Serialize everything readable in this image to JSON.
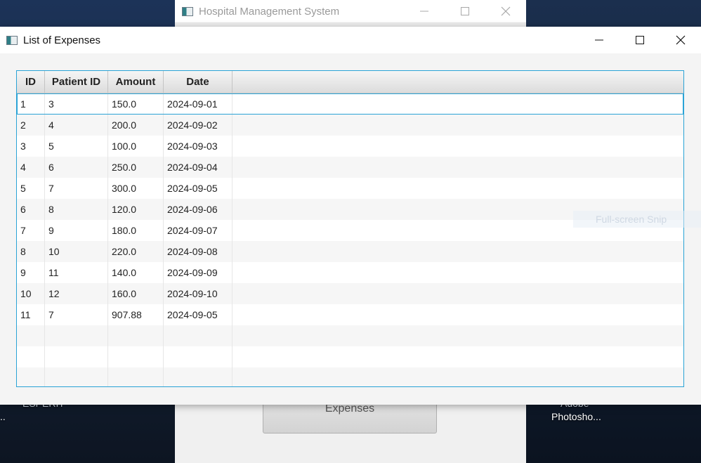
{
  "desktop": {
    "left_partial_label": "ESPERIT",
    "left_dots": "..",
    "right_label_top": "Adobe",
    "right_label_bottom": "Photosho..."
  },
  "back_window": {
    "title": "Hospital Management System",
    "button_label": "Expenses"
  },
  "window": {
    "title": "List of Expenses"
  },
  "table": {
    "columns": [
      "ID",
      "Patient ID",
      "Amount",
      "Date"
    ],
    "rows": [
      [
        "1",
        "3",
        "150.0",
        "2024-09-01"
      ],
      [
        "2",
        "4",
        "200.0",
        "2024-09-02"
      ],
      [
        "3",
        "5",
        "100.0",
        "2024-09-03"
      ],
      [
        "4",
        "6",
        "250.0",
        "2024-09-04"
      ],
      [
        "5",
        "7",
        "300.0",
        "2024-09-05"
      ],
      [
        "6",
        "8",
        "120.0",
        "2024-09-06"
      ],
      [
        "7",
        "9",
        "180.0",
        "2024-09-07"
      ],
      [
        "8",
        "10",
        "220.0",
        "2024-09-08"
      ],
      [
        "9",
        "11",
        "140.0",
        "2024-09-09"
      ],
      [
        "10",
        "12",
        "160.0",
        "2024-09-10"
      ],
      [
        "11",
        "7",
        "907.88",
        "2024-09-05"
      ],
      [
        "",
        "",
        "",
        ""
      ],
      [
        "",
        "",
        "",
        ""
      ],
      [
        "",
        "",
        "",
        ""
      ]
    ],
    "selected_row": 0
  },
  "overlay": {
    "snip_label": "Full-screen Snip"
  },
  "colors": {
    "accent": "#2aa3d6"
  }
}
